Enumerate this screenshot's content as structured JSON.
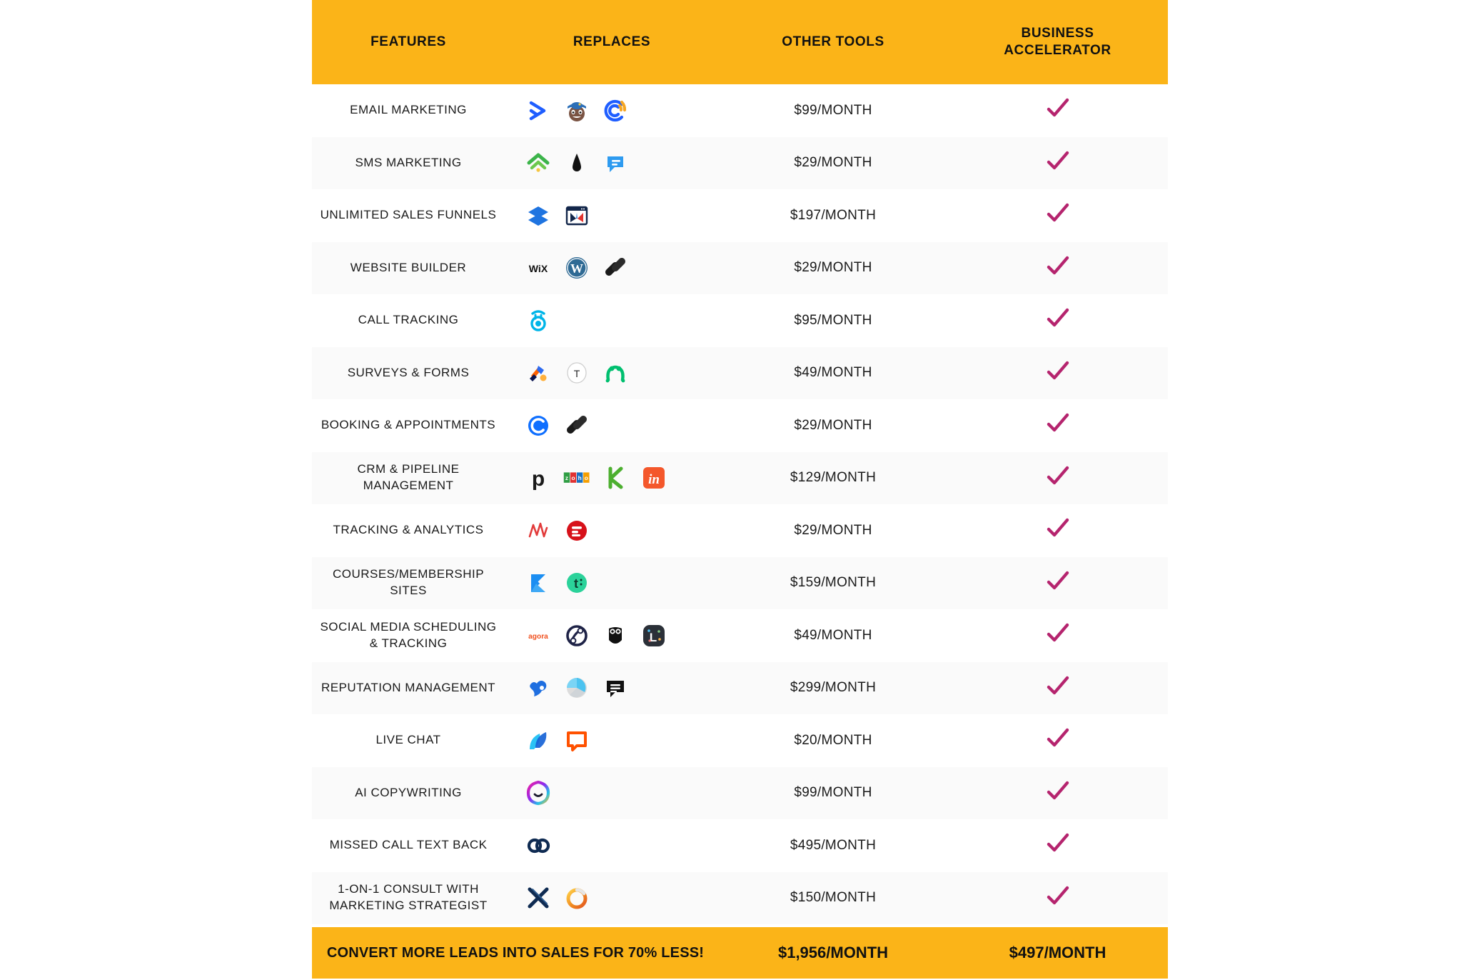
{
  "table": {
    "accent_yellow": "#FBB418",
    "check_color": "#B5246E",
    "headers": {
      "features": "FEATURES",
      "replaces": "REPLACES",
      "other_tools": "OTHER TOOLS",
      "business_accelerator_line1": "BUSINESS",
      "business_accelerator_line2": "ACCELERATOR"
    },
    "rows": [
      {
        "feature": "EMAIL MARKETING",
        "logos": [
          "activecampaign",
          "mailchimp",
          "constantcontact"
        ],
        "other_tools_price": "$99/MONTH",
        "included": true
      },
      {
        "feature": "SMS MARKETING",
        "logos": [
          "simpletexting",
          "attentive",
          "podium"
        ],
        "other_tools_price": "$29/MONTH",
        "included": true
      },
      {
        "feature": "UNLIMITED SALES FUNNELS",
        "logos": [
          "clickfunnels",
          "leadpages"
        ],
        "other_tools_price": "$197/MONTH",
        "included": true
      },
      {
        "feature": "WEBSITE BUILDER",
        "logos": [
          "wix",
          "wordpress",
          "squarespace"
        ],
        "other_tools_price": "$29/MONTH",
        "included": true
      },
      {
        "feature": "CALL TRACKING",
        "logos": [
          "callrail"
        ],
        "other_tools_price": "$95/MONTH",
        "included": true
      },
      {
        "feature": "SURVEYS & FORMS",
        "logos": [
          "jotform",
          "typeform",
          "surveymonkey"
        ],
        "other_tools_price": "$49/MONTH",
        "included": true
      },
      {
        "feature": "BOOKING & APPOINTMENTS",
        "logos": [
          "calendly",
          "squarespace"
        ],
        "other_tools_price": "$29/MONTH",
        "included": true
      },
      {
        "feature": "CRM & PIPELINE MANAGEMENT",
        "logos": [
          "pipedrive",
          "zoho",
          "keap",
          "insightly"
        ],
        "other_tools_price": "$129/MONTH",
        "included": true
      },
      {
        "feature": "TRACKING & ANALYTICS",
        "logos": [
          "wicked-reports",
          "hyros"
        ],
        "other_tools_price": "$29/MONTH",
        "included": true
      },
      {
        "feature": "COURSES/MEMBERSHIP SITES",
        "logos": [
          "kajabi",
          "teachable"
        ],
        "other_tools_price": "$159/MONTH",
        "included": true
      },
      {
        "feature": "SOCIAL MEDIA SCHEDULING & TRACKING",
        "logos": [
          "agorapulse",
          "sendible",
          "hootsuite",
          "later"
        ],
        "other_tools_price": "$49/MONTH",
        "included": true
      },
      {
        "feature": "REPUTATION MANAGEMENT",
        "logos": [
          "birdeye",
          "reputation",
          "podium-chat"
        ],
        "other_tools_price": "$299/MONTH",
        "included": true
      },
      {
        "feature": "LIVE CHAT",
        "logos": [
          "drift",
          "livechat"
        ],
        "other_tools_price": "$20/MONTH",
        "included": true
      },
      {
        "feature": "AI COPYWRITING",
        "logos": [
          "jasper"
        ],
        "other_tools_price": "$99/MONTH",
        "included": true
      },
      {
        "feature": "MISSED CALL TEXT BACK",
        "logos": [
          "numa"
        ],
        "other_tools_price": "$495/MONTH",
        "included": true
      },
      {
        "feature": "1-ON-1 CONSULT WITH MARKETING STRATEGIST",
        "logos": [
          "xmark",
          "ring"
        ],
        "other_tools_price": "$150/MONTH",
        "included": true
      }
    ],
    "footer": {
      "message": "CONVERT MORE LEADS INTO SALES FOR 70% LESS!",
      "other_tools_total": "$1,956/MONTH",
      "business_accelerator_total": "$497/MONTH"
    }
  }
}
